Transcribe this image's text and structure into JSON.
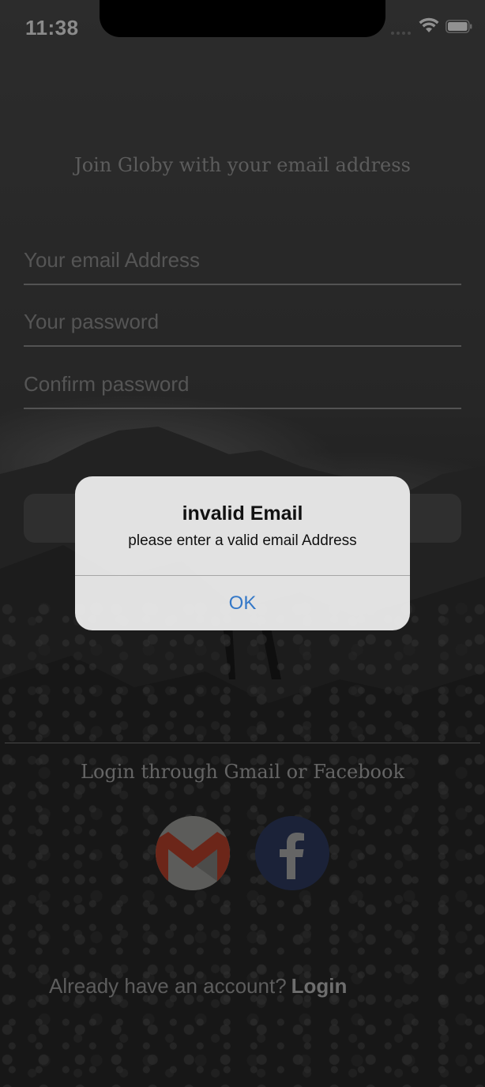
{
  "status_bar": {
    "time": "11:38",
    "icons": [
      "cellular-signal-icon",
      "wifi-icon",
      "battery-icon"
    ]
  },
  "signup": {
    "heading": "Join Globy with your email address",
    "email_placeholder": "Your email Address",
    "password_placeholder": "Your password",
    "confirm_placeholder": "Confirm password",
    "email_value": "",
    "password_value": "",
    "confirm_value": ""
  },
  "social": {
    "heading": "Login through Gmail or Facebook",
    "icons": [
      "gmail-icon",
      "facebook-icon"
    ]
  },
  "footer": {
    "prompt": "Already have an account?",
    "login_label": "Login"
  },
  "alert": {
    "title": "invalid Email",
    "message": "please enter a valid email Address",
    "ok_label": "OK"
  },
  "colors": {
    "alert_button": "#3478c8",
    "facebook": "#2d3a5e",
    "gmail_red": "#b5402b"
  }
}
